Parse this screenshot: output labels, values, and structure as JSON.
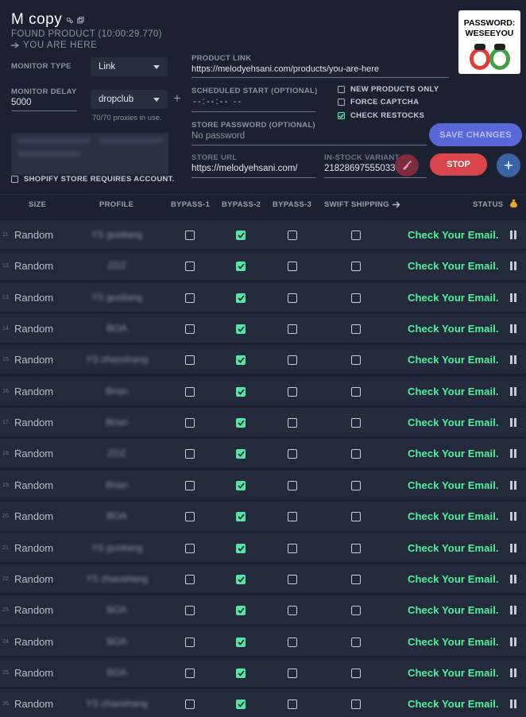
{
  "task": {
    "title": "M copy",
    "found_product": "FOUND PRODUCT (10:00:29.770)",
    "product_name": "YOU ARE HERE"
  },
  "form": {
    "monitor_type_label": "MONITOR TYPE",
    "monitor_type_value": "Link",
    "monitor_delay_label": "MONITOR DELAY",
    "monitor_delay_value": "5000",
    "proxy_value": "dropclub",
    "proxy_hint": "70/70 proxies in use.",
    "product_link_label": "PRODUCT LINK",
    "product_link_value": "https://melodyehsani.com/products/you-are-here",
    "scheduled_start_label": "SCHEDULED START (OPTIONAL)",
    "scheduled_start_value": "--:--:-- --",
    "store_password_label": "STORE PASSWORD (OPTIONAL)",
    "store_password_placeholder": "No password",
    "store_url_label": "STORE URL",
    "store_url_value": "https://melodyehsani.com/",
    "in_stock_variant_label": "IN-STOCK VARIANT",
    "in_stock_variant_value": "21828697555033",
    "new_products_only": "NEW PRODUCTS ONLY",
    "force_captcha": "FORCE CAPTCHA",
    "check_restocks": "CHECK RESTOCKS",
    "shopify_requires_account": "SHOPIFY STORE REQUIRES ACCOUNT."
  },
  "buttons": {
    "save_changes": "SAVE CHANGES",
    "stop": "STOP"
  },
  "badge": {
    "line1": "PASSWORD:",
    "line2": "WESEEYOU"
  },
  "table": {
    "headers": {
      "size": "SIZE",
      "profile": "PROFILE",
      "bypass1": "BYPASS-1",
      "bypass2": "BYPASS-2",
      "bypass3": "BYPASS-3",
      "swift": "SWIFT SHIPPING",
      "status": "STATUS"
    },
    "rows": [
      {
        "idx": "11.",
        "size": "Random",
        "profile": "YS guoliang",
        "bypass1": false,
        "bypass2": true,
        "bypass3": false,
        "swift": false,
        "status": "Check Your Email."
      },
      {
        "idx": "12.",
        "size": "Random",
        "profile": "ZDZ",
        "bypass1": false,
        "bypass2": true,
        "bypass3": false,
        "swift": false,
        "status": "Check Your Email."
      },
      {
        "idx": "13.",
        "size": "Random",
        "profile": "YS guoliang",
        "bypass1": false,
        "bypass2": true,
        "bypass3": false,
        "swift": false,
        "status": "Check Your Email."
      },
      {
        "idx": "14.",
        "size": "Random",
        "profile": "BOA",
        "bypass1": false,
        "bypass2": true,
        "bypass3": false,
        "swift": false,
        "status": "Check Your Email."
      },
      {
        "idx": "15.",
        "size": "Random",
        "profile": "YS zhaoshang",
        "bypass1": false,
        "bypass2": true,
        "bypass3": false,
        "swift": false,
        "status": "Check Your Email."
      },
      {
        "idx": "16.",
        "size": "Random",
        "profile": "Brian",
        "bypass1": false,
        "bypass2": true,
        "bypass3": false,
        "swift": false,
        "status": "Check Your Email."
      },
      {
        "idx": "17.",
        "size": "Random",
        "profile": "Brian",
        "bypass1": false,
        "bypass2": true,
        "bypass3": false,
        "swift": false,
        "status": "Check Your Email."
      },
      {
        "idx": "18.",
        "size": "Random",
        "profile": "ZDZ",
        "bypass1": false,
        "bypass2": true,
        "bypass3": false,
        "swift": false,
        "status": "Check Your Email."
      },
      {
        "idx": "19.",
        "size": "Random",
        "profile": "Brian",
        "bypass1": false,
        "bypass2": true,
        "bypass3": false,
        "swift": false,
        "status": "Check Your Email."
      },
      {
        "idx": "20.",
        "size": "Random",
        "profile": "BOA",
        "bypass1": false,
        "bypass2": true,
        "bypass3": false,
        "swift": false,
        "status": "Check Your Email."
      },
      {
        "idx": "21.",
        "size": "Random",
        "profile": "YS guoliang",
        "bypass1": false,
        "bypass2": true,
        "bypass3": false,
        "swift": false,
        "status": "Check Your Email."
      },
      {
        "idx": "22.",
        "size": "Random",
        "profile": "YS zhaoshang",
        "bypass1": false,
        "bypass2": true,
        "bypass3": false,
        "swift": false,
        "status": "Check Your Email."
      },
      {
        "idx": "23.",
        "size": "Random",
        "profile": "BOA",
        "bypass1": false,
        "bypass2": true,
        "bypass3": false,
        "swift": false,
        "status": "Check Your Email."
      },
      {
        "idx": "24.",
        "size": "Random",
        "profile": "BOA",
        "bypass1": false,
        "bypass2": true,
        "bypass3": false,
        "swift": false,
        "status": "Check Your Email."
      },
      {
        "idx": "25.",
        "size": "Random",
        "profile": "BOA",
        "bypass1": false,
        "bypass2": true,
        "bypass3": false,
        "swift": false,
        "status": "Check Your Email."
      },
      {
        "idx": "26.",
        "size": "Random",
        "profile": "YS zhaoshang",
        "bypass1": false,
        "bypass2": true,
        "bypass3": false,
        "swift": false,
        "status": "Check Your Email."
      }
    ]
  },
  "colors": {
    "background": "#1b2130",
    "row": "#232a3b",
    "status_green": "#4ff29c",
    "save_button": "#5a67d8",
    "stop_button": "#d9454b"
  }
}
